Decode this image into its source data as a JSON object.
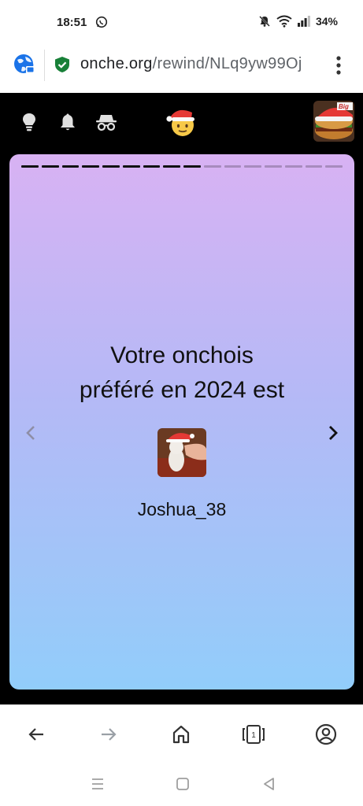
{
  "status_bar": {
    "time": "18:51",
    "battery": "34%"
  },
  "url_bar": {
    "domain": "onche.org",
    "path": "/rewind/NLq9yw99Oj"
  },
  "header": {
    "avatar_label": "Big"
  },
  "card": {
    "progress": {
      "completed": 9,
      "total": 16
    },
    "title_line1": "Votre onchois",
    "title_line2": "préféré en 2024 est",
    "winner_name": "Joshua_38"
  },
  "colors": {
    "gradient_top": "#d8b2f3",
    "gradient_bottom": "#92cdfa",
    "header_bg": "#000000"
  },
  "icons": [
    "whatsapp-icon",
    "mute-icon",
    "wifi-icon",
    "signal-icon",
    "globe-lock-icon",
    "secure-lock-icon",
    "more-menu-icon",
    "lightbulb-icon",
    "bell-icon",
    "incognito-icon",
    "santa-emoji-icon",
    "chevron-left-icon",
    "chevron-right-icon",
    "back-arrow-icon",
    "forward-arrow-icon",
    "home-icon",
    "tabs-icon",
    "account-icon"
  ],
  "toolbar": {
    "tabs_count": "1"
  }
}
